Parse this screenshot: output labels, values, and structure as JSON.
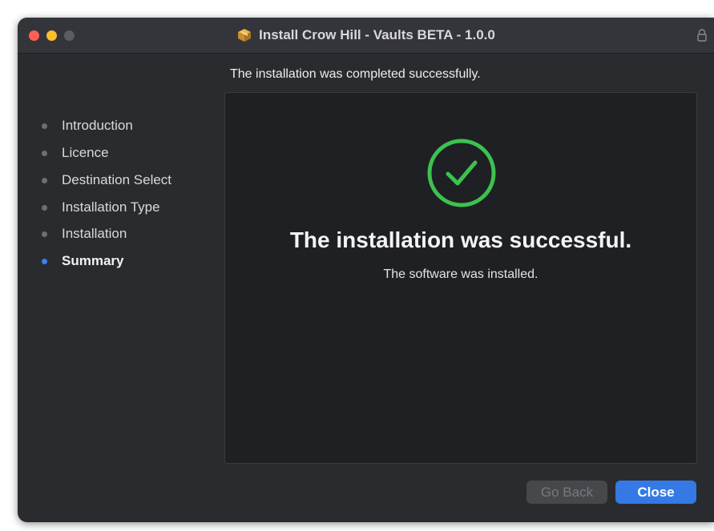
{
  "window": {
    "title": "Install Crow Hill - Vaults BETA - 1.0.0"
  },
  "header": {
    "message": "The installation was completed successfully."
  },
  "sidebar": {
    "items": [
      {
        "label": "Introduction",
        "active": false
      },
      {
        "label": "Licence",
        "active": false
      },
      {
        "label": "Destination Select",
        "active": false
      },
      {
        "label": "Installation Type",
        "active": false
      },
      {
        "label": "Installation",
        "active": false
      },
      {
        "label": "Summary",
        "active": true
      }
    ]
  },
  "main": {
    "headline": "The installation was successful.",
    "subtext": "The software was installed."
  },
  "buttons": {
    "back_label": "Go Back",
    "close_label": "Close"
  },
  "colors": {
    "accent": "#3579e6",
    "success": "#3cc24f",
    "close": "#fe5f57",
    "minimize": "#febc2e"
  },
  "icons": {
    "title": "package-icon",
    "lock": "lock-icon",
    "status": "checkmark-circle-icon"
  }
}
